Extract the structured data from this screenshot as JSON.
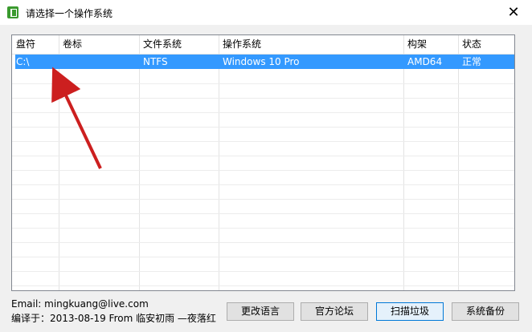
{
  "window": {
    "title": "请选择一个操作系统",
    "close_glyph": "✕"
  },
  "table": {
    "columns": [
      "盘符",
      "卷标",
      "文件系统",
      "操作系统",
      "构架",
      "状态"
    ],
    "rows": [
      [
        "C:\\",
        "",
        "NTFS",
        "Windows 10 Pro",
        "AMD64",
        "正常"
      ]
    ]
  },
  "footer": {
    "email": "Email:  mingkuang@live.com",
    "compile": "编译于：2013-08-19 From 临安初雨 —夜落红"
  },
  "buttons": {
    "change_language": "更改语言",
    "official_forum": "官方论坛",
    "scan_junk": "扫描垃圾",
    "system_backup": "系统备份"
  },
  "annotation": {
    "arrow_color": "#cc1f1f"
  },
  "colors": {
    "selection": "#3399ff",
    "icon": "#3a9a2e"
  }
}
